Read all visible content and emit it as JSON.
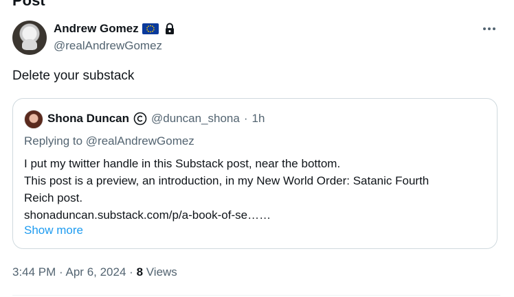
{
  "header": {
    "title_partial": "Post"
  },
  "author": {
    "name": "Andrew Gomez",
    "handle": "@realAndrewGomez",
    "badges": [
      "eu-flag-icon",
      "lock-icon"
    ]
  },
  "tweet": {
    "text": "Delete your substack"
  },
  "quoted": {
    "name": "Shona Duncan",
    "handle": "@duncan_shona",
    "separator": "·",
    "time": "1h",
    "replying_to": "Replying to @realAndrewGomez",
    "lines": [
      "I put my twitter handle in this Substack post, near the bottom.",
      "This post is a preview, an introduction, in my New World Order: Satanic Fourth",
      "Reich post.",
      "shonaduncan.substack.com/p/a-book-of-se……"
    ],
    "show_more": "Show more"
  },
  "meta": {
    "time": "3:44 PM",
    "sep1": "·",
    "date": "Apr 6, 2024",
    "sep2": "·",
    "views_count": "8",
    "views_label": "Views"
  },
  "colors": {
    "text": "#0f1419",
    "secondary": "#536471",
    "link": "#1d9bf0",
    "border": "#cfd9de"
  }
}
